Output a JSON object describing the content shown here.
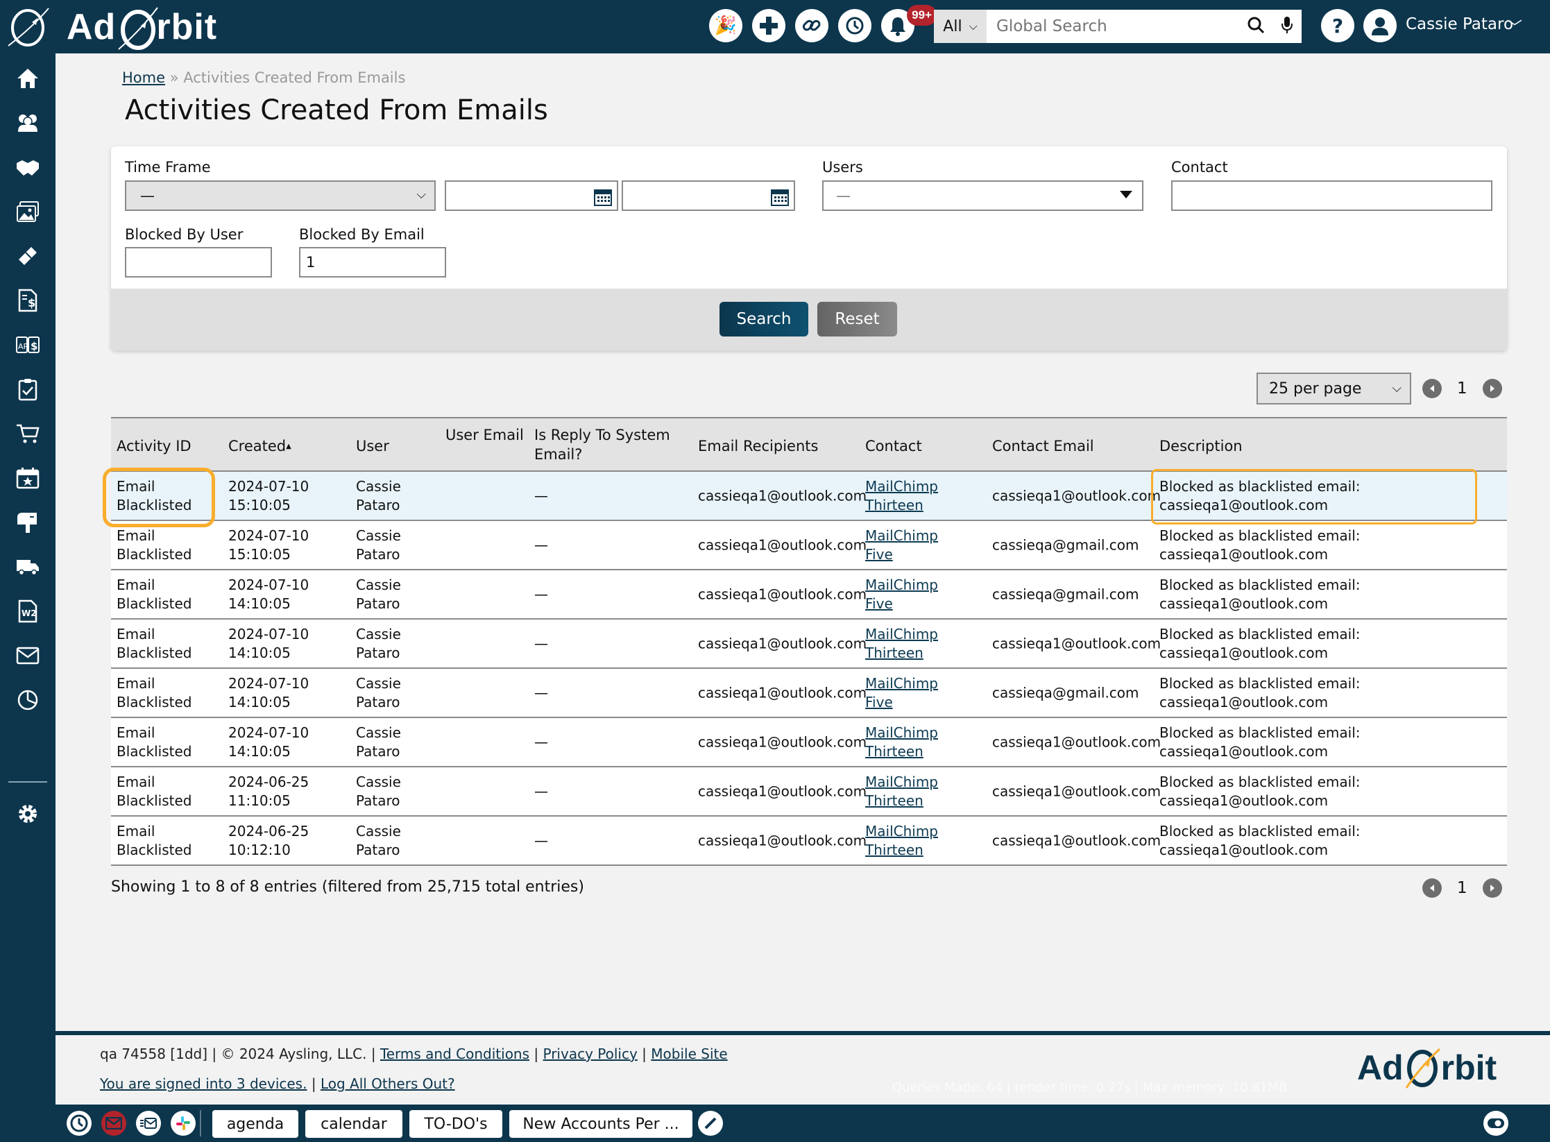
{
  "app": {
    "name": "Ad Orbit",
    "logo_part1": "Ad",
    "logo_part2": "rbit"
  },
  "topbar": {
    "icons": [
      "party-popper-icon",
      "plus-icon",
      "link-icon",
      "history-icon",
      "bell-icon"
    ],
    "notification_badge": "99+",
    "search_scope": "All",
    "search_placeholder": "Global Search",
    "user_name": "Cassie Pataro"
  },
  "sidebar": {
    "items": [
      "home",
      "contacts",
      "deals",
      "media",
      "tickets",
      "invoices",
      "ap-ar",
      "tasks",
      "orders",
      "events",
      "mailbox",
      "delivery",
      "w2-forms",
      "email",
      "reports",
      "settings"
    ]
  },
  "breadcrumb": {
    "home": "Home",
    "separator": "»",
    "current": "Activities Created From Emails"
  },
  "page_title": "Activities Created From Emails",
  "filters": {
    "time_frame_label": "Time Frame",
    "time_frame_value": "—",
    "date_from": "",
    "date_to": "",
    "users_label": "Users",
    "users_value": "—",
    "contact_label": "Contact",
    "contact_value": "",
    "blocked_by_user_label": "Blocked By User",
    "blocked_by_user_value": "",
    "blocked_by_email_label": "Blocked By Email",
    "blocked_by_email_value": "1",
    "search_button": "Search",
    "reset_button": "Reset"
  },
  "pagination": {
    "per_page": "25 per page",
    "current_page": "1"
  },
  "table": {
    "columns": [
      "Activity ID",
      "Created",
      "User",
      "User Email",
      "Is Reply To System Email?",
      "Email Recipients",
      "Contact",
      "Contact Email",
      "Description"
    ],
    "sort_indicator": "▲",
    "rows": [
      {
        "activity_id": "Email Blacklisted",
        "created_date": "2024-07-10",
        "created_time": "15:10:05",
        "user_first": "Cassie",
        "user_last": "Pataro",
        "user_email": "",
        "is_reply": "—",
        "recipients": "cassieqa1@outlook.com",
        "contact": "MailChimp Thirteen",
        "contact_email": "cassieqa1@outlook.com",
        "desc1": "Blocked as blacklisted email:",
        "desc2": "cassieqa1@outlook.com"
      },
      {
        "activity_id": "Email Blacklisted",
        "created_date": "2024-07-10",
        "created_time": "15:10:05",
        "user_first": "Cassie",
        "user_last": "Pataro",
        "user_email": "",
        "is_reply": "—",
        "recipients": "cassieqa1@outlook.com",
        "contact": "MailChimp Five",
        "contact_email": "cassieqa@gmail.com",
        "desc1": "Blocked as blacklisted email:",
        "desc2": "cassieqa1@outlook.com"
      },
      {
        "activity_id": "Email Blacklisted",
        "created_date": "2024-07-10",
        "created_time": "14:10:05",
        "user_first": "Cassie",
        "user_last": "Pataro",
        "user_email": "",
        "is_reply": "—",
        "recipients": "cassieqa1@outlook.com",
        "contact": "MailChimp Five",
        "contact_email": "cassieqa@gmail.com",
        "desc1": "Blocked as blacklisted email:",
        "desc2": "cassieqa1@outlook.com"
      },
      {
        "activity_id": "Email Blacklisted",
        "created_date": "2024-07-10",
        "created_time": "14:10:05",
        "user_first": "Cassie",
        "user_last": "Pataro",
        "user_email": "",
        "is_reply": "—",
        "recipients": "cassieqa1@outlook.com",
        "contact": "MailChimp Thirteen",
        "contact_email": "cassieqa1@outlook.com",
        "desc1": "Blocked as blacklisted email:",
        "desc2": "cassieqa1@outlook.com"
      },
      {
        "activity_id": "Email Blacklisted",
        "created_date": "2024-07-10",
        "created_time": "14:10:05",
        "user_first": "Cassie",
        "user_last": "Pataro",
        "user_email": "",
        "is_reply": "—",
        "recipients": "cassieqa1@outlook.com",
        "contact": "MailChimp Five",
        "contact_email": "cassieqa@gmail.com",
        "desc1": "Blocked as blacklisted email:",
        "desc2": "cassieqa1@outlook.com"
      },
      {
        "activity_id": "Email Blacklisted",
        "created_date": "2024-07-10",
        "created_time": "14:10:05",
        "user_first": "Cassie",
        "user_last": "Pataro",
        "user_email": "",
        "is_reply": "—",
        "recipients": "cassieqa1@outlook.com",
        "contact": "MailChimp Thirteen",
        "contact_email": "cassieqa1@outlook.com",
        "desc1": "Blocked as blacklisted email:",
        "desc2": "cassieqa1@outlook.com"
      },
      {
        "activity_id": "Email Blacklisted",
        "created_date": "2024-06-25",
        "created_time": "11:10:05",
        "user_first": "Cassie",
        "user_last": "Pataro",
        "user_email": "",
        "is_reply": "—",
        "recipients": "cassieqa1@outlook.com",
        "contact": "MailChimp Thirteen",
        "contact_email": "cassieqa1@outlook.com",
        "desc1": "Blocked as blacklisted email:",
        "desc2": "cassieqa1@outlook.com"
      },
      {
        "activity_id": "Email Blacklisted",
        "created_date": "2024-06-25",
        "created_time": "10:12:10",
        "user_first": "Cassie",
        "user_last": "Pataro",
        "user_email": "",
        "is_reply": "—",
        "recipients": "cassieqa1@outlook.com",
        "contact": "MailChimp Thirteen",
        "contact_email": "cassieqa1@outlook.com",
        "desc1": "Blocked as blacklisted email:",
        "desc2": "cassieqa1@outlook.com"
      }
    ]
  },
  "showing_text": "Showing 1 to 8 of 8 entries (filtered from 25,715 total entries)",
  "footer": {
    "build": "qa 74558 [1dd] | © 2024 Aysling, LLC. |",
    "terms": "Terms and Conditions",
    "privacy": "Privacy Policy",
    "mobile": "Mobile Site",
    "sep": "|",
    "devices": "You are signed into 3 devices.",
    "logout_others": "Log All Others Out?",
    "stats": "Queries Made: 64 | render time: 0.27s | Max memory: 10.81MB"
  },
  "bottombar": {
    "tabs": [
      "agenda",
      "calendar",
      "TO-DO's",
      "New Accounts Per ..."
    ]
  },
  "colors": {
    "brand_navy": "#0d364d",
    "highlight_orange": "#f9ad2c",
    "badge_red": "#b3232b",
    "selected_row": "#e8f4fa"
  }
}
